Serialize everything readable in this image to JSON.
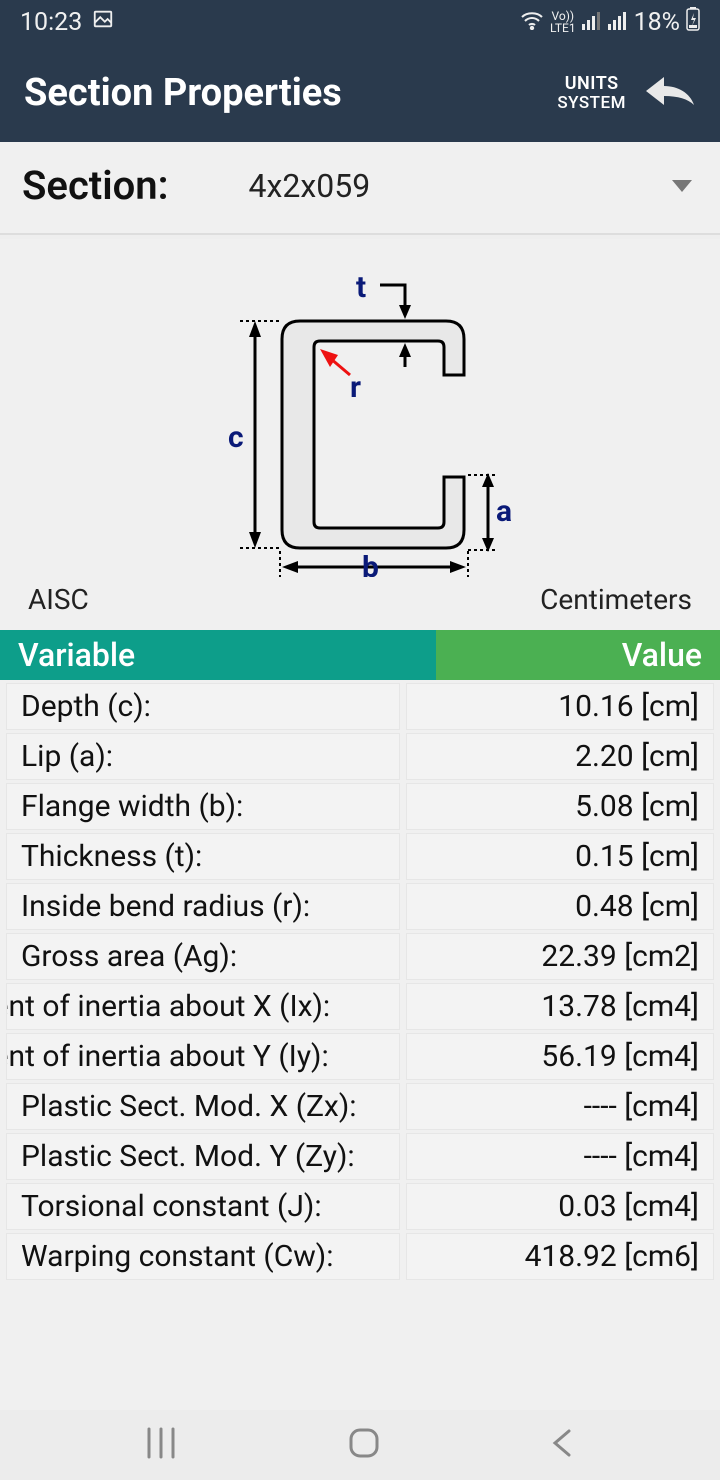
{
  "status": {
    "time": "10:23",
    "lte": "LTE1",
    "vo": "Vo))",
    "battery": "18%"
  },
  "header": {
    "title": "Section Properties",
    "units_line1": "UNITS",
    "units_line2": "SYSTEM"
  },
  "section": {
    "label": "Section:",
    "value": "4x2x059"
  },
  "diagram": {
    "labels": {
      "t": "t",
      "r": "r",
      "c": "c",
      "b": "b",
      "a": "a"
    },
    "std": "AISC",
    "unit": "Centimeters"
  },
  "table": {
    "head_var": "Variable",
    "head_val": "Value",
    "rows": [
      {
        "var": "Depth (c):",
        "val": "10.16 [cm]",
        "offset": false
      },
      {
        "var": "Lip (a):",
        "val": "2.20 [cm]",
        "offset": false
      },
      {
        "var": "Flange width (b):",
        "val": "5.08 [cm]",
        "offset": false
      },
      {
        "var": "Thickness (t):",
        "val": "0.15 [cm]",
        "offset": false
      },
      {
        "var": "Inside bend radius (r):",
        "val": "0.48 [cm]",
        "offset": false
      },
      {
        "var": "Gross area (Ag):",
        "val": "22.39 [cm2]",
        "offset": false
      },
      {
        "var": "Moment of inertia about X (Ix):",
        "val": "13.78 [cm4]",
        "offset": true
      },
      {
        "var": "Moment of inertia about Y (Iy):",
        "val": "56.19 [cm4]",
        "offset": true
      },
      {
        "var": "Plastic Sect. Mod. X (Zx):",
        "val": "---- [cm4]",
        "offset": false
      },
      {
        "var": "Plastic Sect. Mod. Y (Zy):",
        "val": "---- [cm4]",
        "offset": false
      },
      {
        "var": "Torsional constant (J):",
        "val": "0.03 [cm4]",
        "offset": false
      },
      {
        "var": "Warping constant (Cw):",
        "val": "418.92 [cm6]",
        "offset": false
      }
    ]
  }
}
